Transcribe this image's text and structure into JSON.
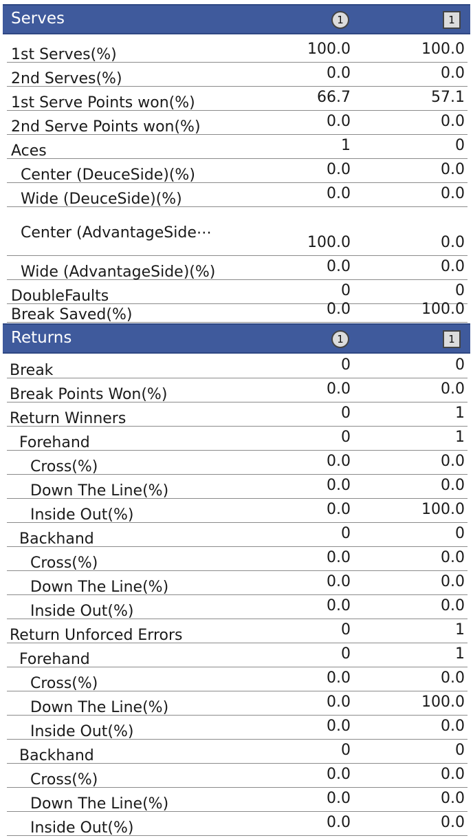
{
  "serves": {
    "title": "Serves",
    "player1_icon": "1",
    "player2_icon": "1",
    "rows": [
      {
        "label": "1st Serves(%)",
        "p1": "100.0",
        "p2": "100.0"
      },
      {
        "label": "2nd Serves(%)",
        "p1": "0.0",
        "p2": "0.0"
      },
      {
        "label": "1st Serve Points won(%)",
        "p1": "66.7",
        "p2": "57.1"
      },
      {
        "label": "2nd Serve Points won(%)",
        "p1": "0.0",
        "p2": "0.0"
      },
      {
        "label": "Aces",
        "p1": "1",
        "p2": "0"
      },
      {
        "label": "Center (DeuceSide)(%)",
        "p1": "0.0",
        "p2": "0.0"
      },
      {
        "label": "Wide (DeuceSide)(%)",
        "p1": "0.0",
        "p2": "0.0"
      },
      {
        "label": "Center (AdvantageSide⋯",
        "p1": "100.0",
        "p2": "0.0"
      },
      {
        "label": "Wide (AdvantageSide)(%)",
        "p1": "0.0",
        "p2": "0.0"
      },
      {
        "label": "DoubleFaults",
        "p1": "0",
        "p2": "0"
      },
      {
        "label": "Break Saved(%)",
        "p1": "0.0",
        "p2": "100.0"
      }
    ]
  },
  "returns": {
    "title": "Returns",
    "player1_icon": "1",
    "player2_icon": "1",
    "rows": [
      {
        "label": "Break",
        "p1": "0",
        "p2": "0"
      },
      {
        "label": "Break Points Won(%)",
        "p1": "0.0",
        "p2": "0.0"
      },
      {
        "label": "Return Winners",
        "p1": "0",
        "p2": "1"
      },
      {
        "label": "Forehand",
        "p1": "0",
        "p2": "1"
      },
      {
        "label": "Cross(%)",
        "p1": "0.0",
        "p2": "0.0"
      },
      {
        "label": "Down The Line(%)",
        "p1": "0.0",
        "p2": "0.0"
      },
      {
        "label": "Inside Out(%)",
        "p1": "0.0",
        "p2": "100.0"
      },
      {
        "label": "Backhand",
        "p1": "0",
        "p2": "0"
      },
      {
        "label": "Cross(%)",
        "p1": "0.0",
        "p2": "0.0"
      },
      {
        "label": "Down The Line(%)",
        "p1": "0.0",
        "p2": "0.0"
      },
      {
        "label": "Inside Out(%)",
        "p1": "0.0",
        "p2": "0.0"
      },
      {
        "label": "Return Unforced Errors",
        "p1": "0",
        "p2": "1"
      },
      {
        "label": "Forehand",
        "p1": "0",
        "p2": "1"
      },
      {
        "label": "Cross(%)",
        "p1": "0.0",
        "p2": "0.0"
      },
      {
        "label": "Down The Line(%)",
        "p1": "0.0",
        "p2": "100.0"
      },
      {
        "label": "Inside Out(%)",
        "p1": "0.0",
        "p2": "0.0"
      },
      {
        "label": "Backhand",
        "p1": "0",
        "p2": "0"
      },
      {
        "label": "Cross(%)",
        "p1": "0.0",
        "p2": "0.0"
      },
      {
        "label": "Down The Line(%)",
        "p1": "0.0",
        "p2": "0.0"
      },
      {
        "label": "Inside Out(%)",
        "p1": "0.0",
        "p2": "0.0"
      }
    ]
  }
}
